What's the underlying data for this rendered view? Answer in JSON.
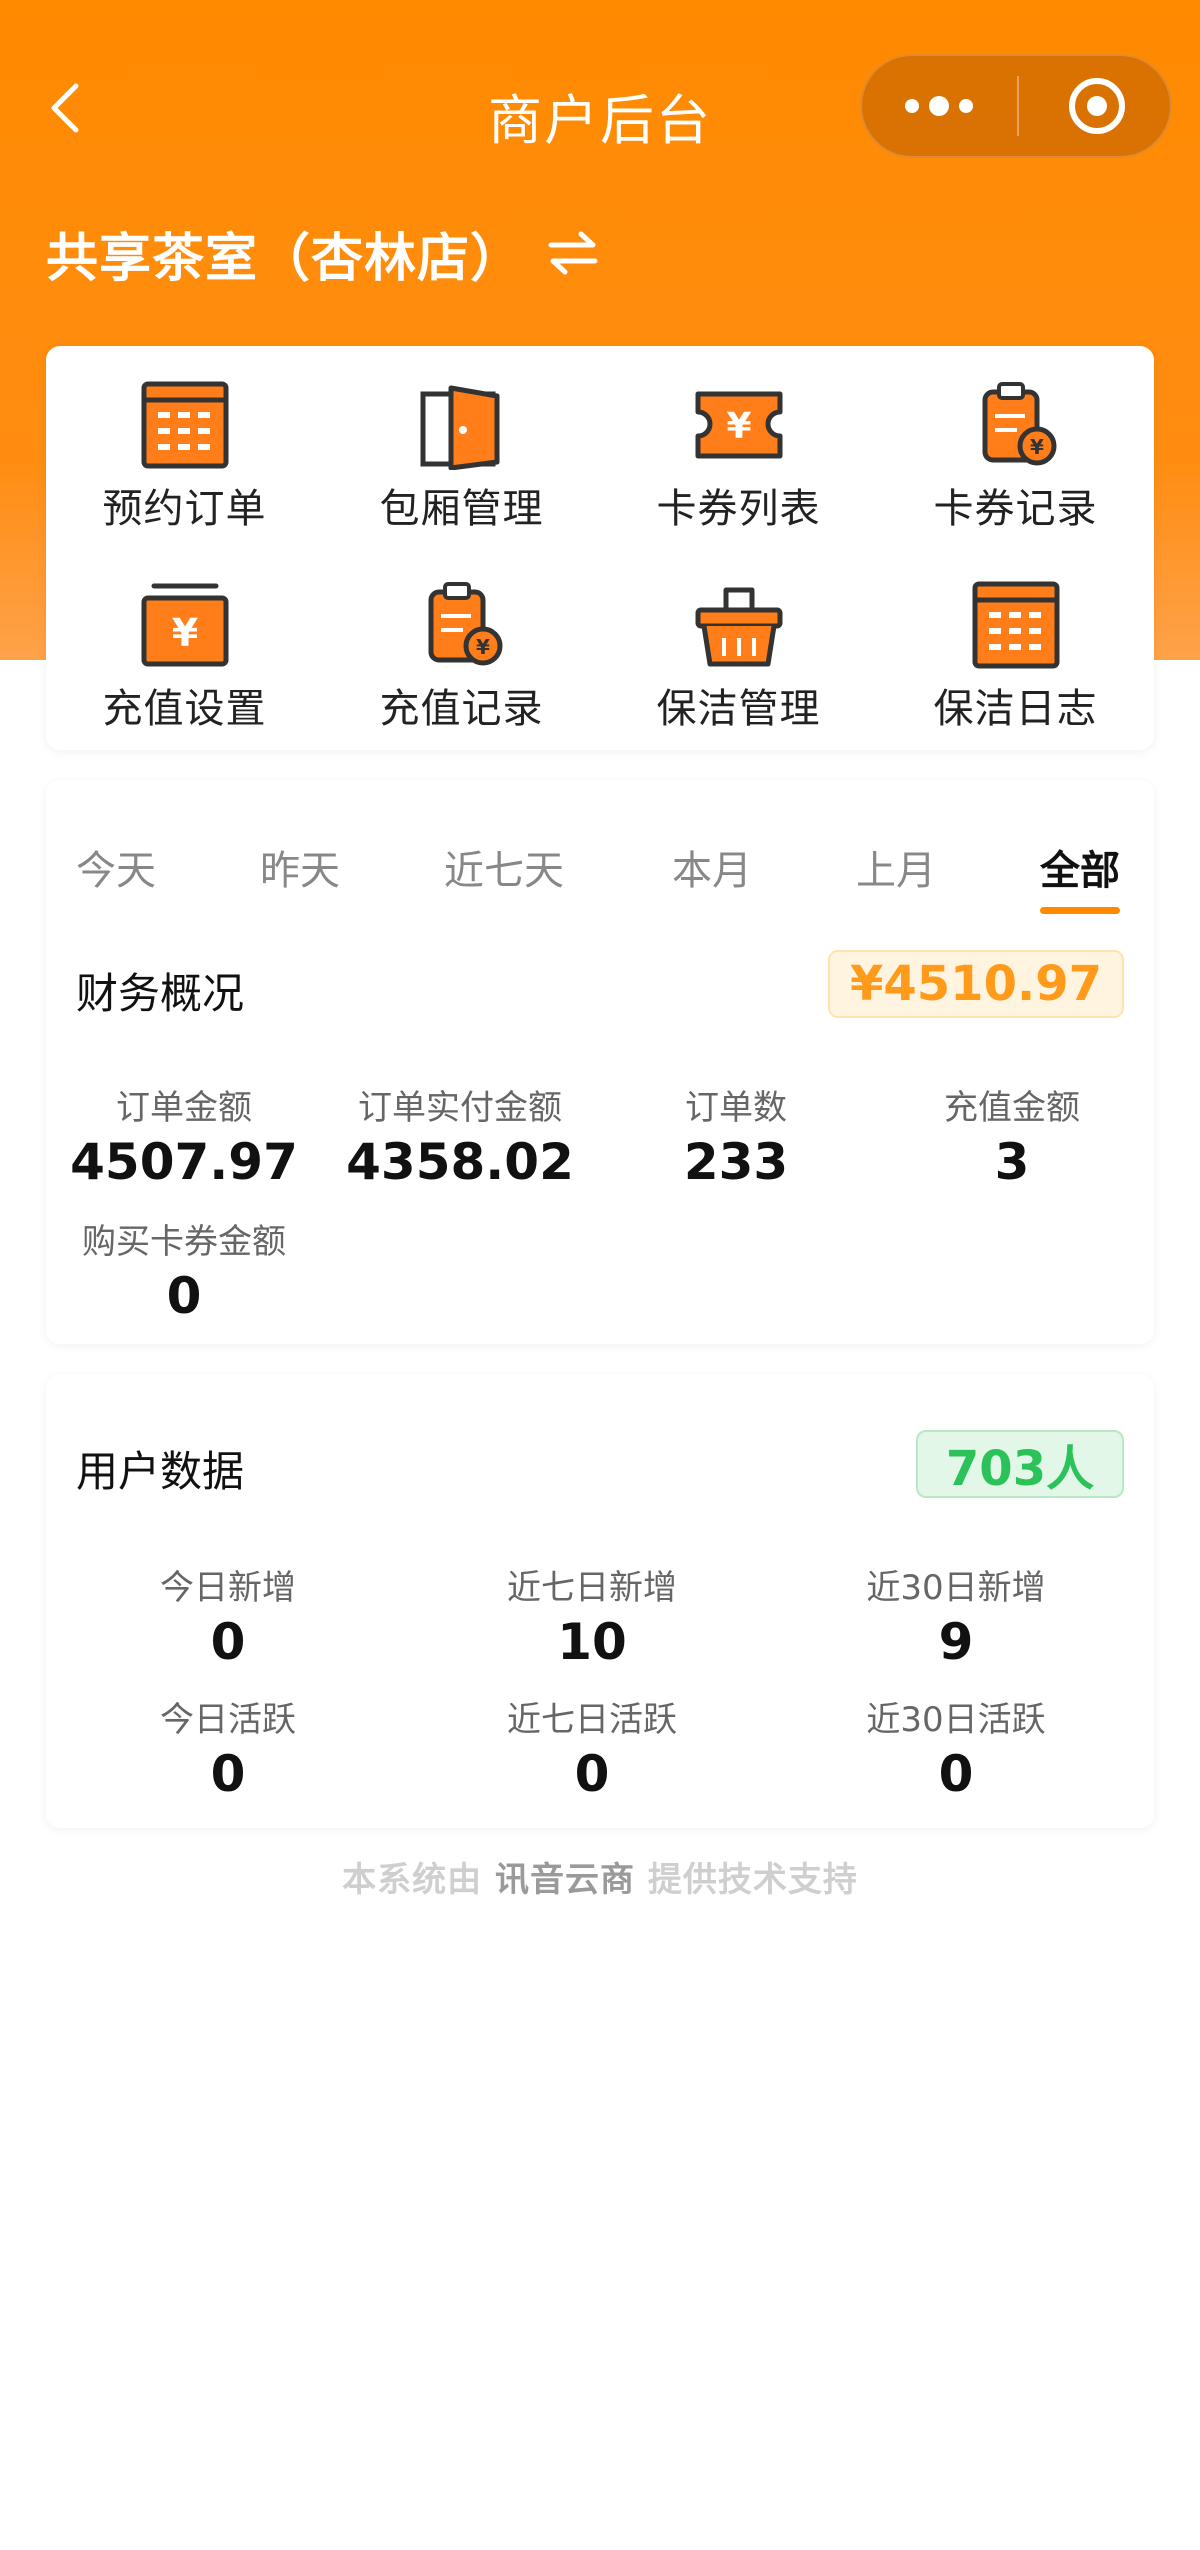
{
  "navbar": {
    "title": "商户后台"
  },
  "store": {
    "name": "共享茶室（杏林店）"
  },
  "menu": {
    "items": [
      {
        "label": "预约订单",
        "icon": "calendar-grid-icon"
      },
      {
        "label": "包厢管理",
        "icon": "door-icon"
      },
      {
        "label": "卡券列表",
        "icon": "ticket-yen-icon"
      },
      {
        "label": "卡券记录",
        "icon": "clipboard-yen-icon"
      },
      {
        "label": "充值设置",
        "icon": "wallet-yen-icon"
      },
      {
        "label": "充值记录",
        "icon": "clipboard-yen-icon"
      },
      {
        "label": "保洁管理",
        "icon": "basket-icon"
      },
      {
        "label": "保洁日志",
        "icon": "calendar-grid-icon"
      }
    ]
  },
  "finance": {
    "tabs": [
      "今天",
      "昨天",
      "近七天",
      "本月",
      "上月",
      "全部"
    ],
    "active_tab": "全部",
    "title": "财务概况",
    "total": "¥4510.97",
    "stats": [
      {
        "label": "订单金额",
        "value": "4507.97"
      },
      {
        "label": "订单实付金额",
        "value": "4358.02"
      },
      {
        "label": "订单数",
        "value": "233"
      },
      {
        "label": "充值金额",
        "value": "3"
      },
      {
        "label": "购买卡券金额",
        "value": "0"
      }
    ]
  },
  "users": {
    "title": "用户数据",
    "total": "703人",
    "stats": [
      {
        "label": "今日新增",
        "value": "0"
      },
      {
        "label": "近七日新增",
        "value": "10"
      },
      {
        "label": "近30日新增",
        "value": "9"
      },
      {
        "label": "今日活跃",
        "value": "0"
      },
      {
        "label": "近七日活跃",
        "value": "0"
      },
      {
        "label": "近30日活跃",
        "value": "0"
      }
    ]
  },
  "footer": {
    "prefix": "本系统由 ",
    "brand": "讯音云商",
    "suffix": " 提供技术支持"
  },
  "colors": {
    "accent": "#ff8a00",
    "icon_orange": "#ff7e1a",
    "icon_outline": "#333333",
    "total_orange": "#ff9a1a",
    "user_green": "#2bc25a"
  }
}
